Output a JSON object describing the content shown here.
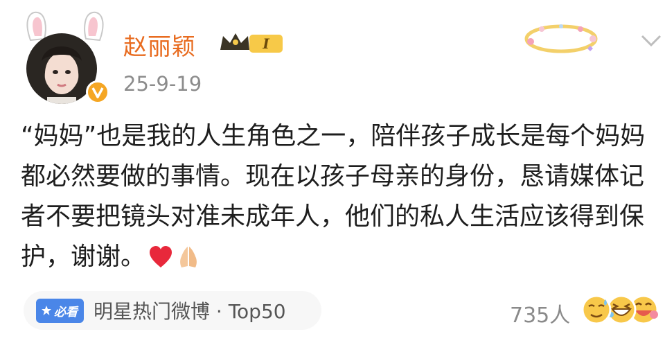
{
  "post": {
    "author": "赵丽颖",
    "level_badge": "I",
    "date": "25-9-19",
    "content": "“妈妈”也是我的人生角色之一，陪伴孩子成长是每个妈妈都必然要做的事情。现在以孩子母亲的身份，恳请媒体记者不要把镜头对准未成年人，他们的私人生活应该得到保护，谢谢。"
  },
  "topic": {
    "badge_label": "必看",
    "text": "明星热门微博 · Top50"
  },
  "reactions": {
    "count": "735人",
    "icons": [
      "sweat-smile-icon",
      "laugh-icon",
      "grin-icon"
    ]
  },
  "icons": {
    "avatar": "user-avatar",
    "verify": "verified-v-icon",
    "crown": "crown-icon",
    "decoration": "heart-wreath-icon",
    "chevron": "chevron-down-icon",
    "heart": "red-heart-icon",
    "pray": "pray-hands-icon",
    "star": "star-icon"
  },
  "colors": {
    "username": "#e86b1f",
    "verify": "#f5a623",
    "badge_blue": "#4a86e8",
    "muted": "#8c8c8c"
  }
}
